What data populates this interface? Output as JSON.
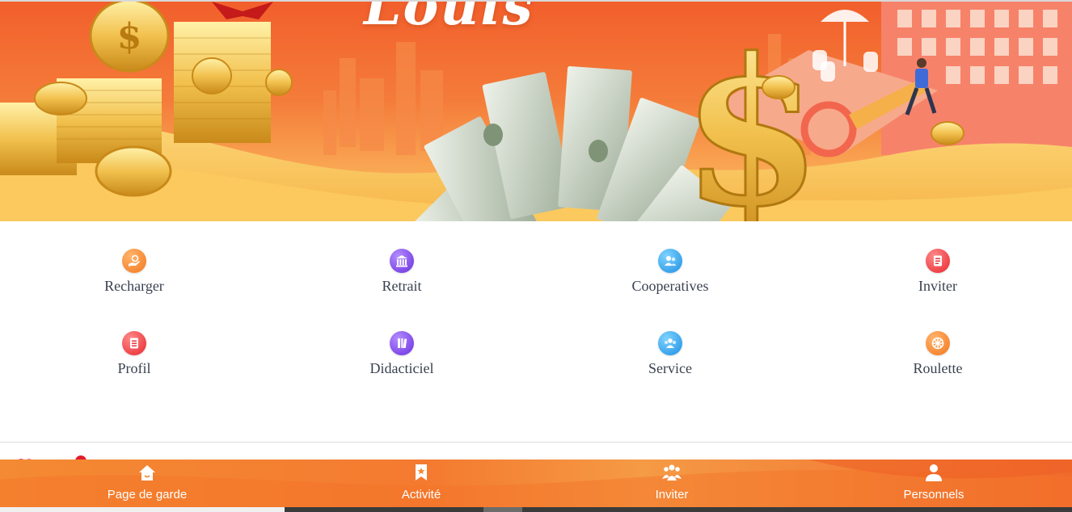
{
  "banner": {
    "brand_text": "Louis",
    "colors": {
      "top": "#f25f2c",
      "bottom": "#fbbf62",
      "gold": "#f2c14e"
    }
  },
  "menu": [
    {
      "label": "Recharger",
      "icon": "recharge-hand-icon",
      "color": "orange"
    },
    {
      "label": "Retrait",
      "icon": "bank-building-icon",
      "color": "purple"
    },
    {
      "label": "Cooperatives",
      "icon": "people-chat-icon",
      "color": "blue"
    },
    {
      "label": "Inviter",
      "icon": "invite-card-icon",
      "color": "red"
    },
    {
      "label": "Profil",
      "icon": "profile-document-icon",
      "color": "red"
    },
    {
      "label": "Didacticiel",
      "icon": "tutorial-book-icon",
      "color": "purple"
    },
    {
      "label": "Service",
      "icon": "customer-service-icon",
      "color": "blue"
    },
    {
      "label": "Roulette",
      "icon": "roulette-wheel-icon",
      "color": "orange"
    }
  ],
  "bottom_nav": [
    {
      "label": "Page de garde",
      "icon": "home-icon"
    },
    {
      "label": "Activité",
      "icon": "bookmark-star-icon"
    },
    {
      "label": "Inviter",
      "icon": "group-users-icon"
    },
    {
      "label": "Personnels",
      "icon": "user-icon"
    }
  ],
  "accent_colors": {
    "nav_bg": "#f47a30",
    "label_text": "#3a4250"
  }
}
